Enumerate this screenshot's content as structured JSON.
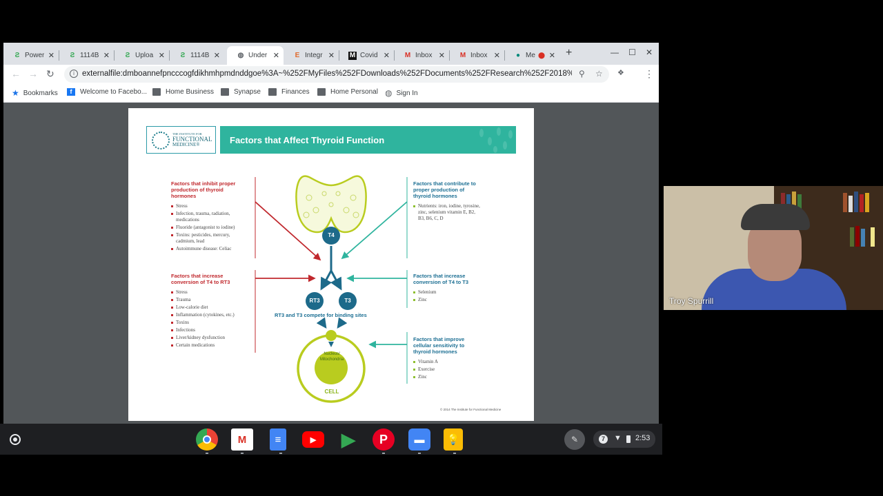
{
  "browser": {
    "tabs": [
      {
        "title": "Power",
        "favicon": "green-s-icon",
        "active": false
      },
      {
        "title": "1114B",
        "favicon": "green-s-icon",
        "active": false
      },
      {
        "title": "Uploa",
        "favicon": "green-s-icon",
        "active": false
      },
      {
        "title": "1114B",
        "favicon": "green-s-icon",
        "active": false
      },
      {
        "title": "Under",
        "favicon": "globe-icon",
        "active": true
      },
      {
        "title": "Integr",
        "favicon": "e-logo-icon",
        "active": false
      },
      {
        "title": "Covid",
        "favicon": "m-logo-icon",
        "active": false
      },
      {
        "title": "Inbox",
        "favicon": "gmail-icon",
        "active": false
      },
      {
        "title": "Inbox",
        "favicon": "gmail-icon",
        "active": false
      },
      {
        "title": "Me",
        "favicon": "meet-icon",
        "active": false
      }
    ],
    "url": "externalfile:dmboannefpncccogfdikhmhpmdnddgoe%3A~%252FMyFiles%252FDownloads%252FDocuments%252FResearch%252F2018%252F5...",
    "bookmarks": [
      {
        "label": "Bookmarks",
        "icon": "star-icon"
      },
      {
        "label": "Welcome to Facebo...",
        "icon": "facebook-icon"
      },
      {
        "label": "Home Business",
        "icon": "folder-icon"
      },
      {
        "label": "Synapse",
        "icon": "folder-icon"
      },
      {
        "label": "Finances",
        "icon": "folder-icon"
      },
      {
        "label": "Home Personal",
        "icon": "folder-icon"
      },
      {
        "label": "Sign In",
        "icon": "globe-icon"
      }
    ]
  },
  "slide": {
    "logo": {
      "line1": "THE INSTITUTE FOR",
      "line2": "FUNCTIONAL",
      "line3": "MEDICINE®"
    },
    "title": "Factors that Affect Thyroid Function",
    "left_sections": [
      {
        "heading": "Factors that inhibit proper production of thyroid hormones",
        "items": [
          "Stress",
          "Infection, trauma, radiation, medications",
          "Fluoride (antagonist to iodine)",
          "Toxins: pesticides, mercury, cadmium, lead",
          "Autoimmune disease: Celiac"
        ]
      },
      {
        "heading": "Factors that increase conversion of T4 to RT3",
        "items": [
          "Stress",
          "Trauma",
          "Low-calorie diet",
          "Inflammation (cytokines, etc.)",
          "Toxins",
          "Infections",
          "Liver/kidney dysfunction",
          "Certain medications"
        ]
      }
    ],
    "right_sections": [
      {
        "heading": "Factors that contribute to proper production of thyroid hormones",
        "items": [
          "Nutrients: iron, iodine, tyrosine, zinc, selenium vitamin E, B2, B3, B6, C, D"
        ]
      },
      {
        "heading": "Factors that increase conversion of T4 to T3",
        "items": [
          "Selenium",
          "Zinc"
        ]
      },
      {
        "heading": "Factors that improve cellular sensitivity to thyroid hormones",
        "items": [
          "Vitamin A",
          "Exercise",
          "Zinc"
        ]
      }
    ],
    "nodes": {
      "t4": "T4",
      "rt3": "RT3",
      "t3": "T3"
    },
    "compete_label": "RT3 and T3 compete for binding sites",
    "nucleus_label": "Nucleus/ Mitochondria",
    "cell_label": "CELL",
    "copyright": "© 2014 The Institute for Functional Medicine",
    "colors": {
      "teal": "#2fb49e",
      "red": "#c0282d",
      "blue": "#1d6a8a",
      "lime": "#a8c520"
    }
  },
  "video": {
    "name": "Troy Spurrill"
  },
  "shelf": {
    "apps": [
      "chrome-icon",
      "gmail-icon",
      "docs-icon",
      "youtube-icon",
      "play-store-icon",
      "pinterest-icon",
      "files-icon",
      "keep-icon"
    ],
    "notification_count": "7",
    "time": "2:53"
  }
}
